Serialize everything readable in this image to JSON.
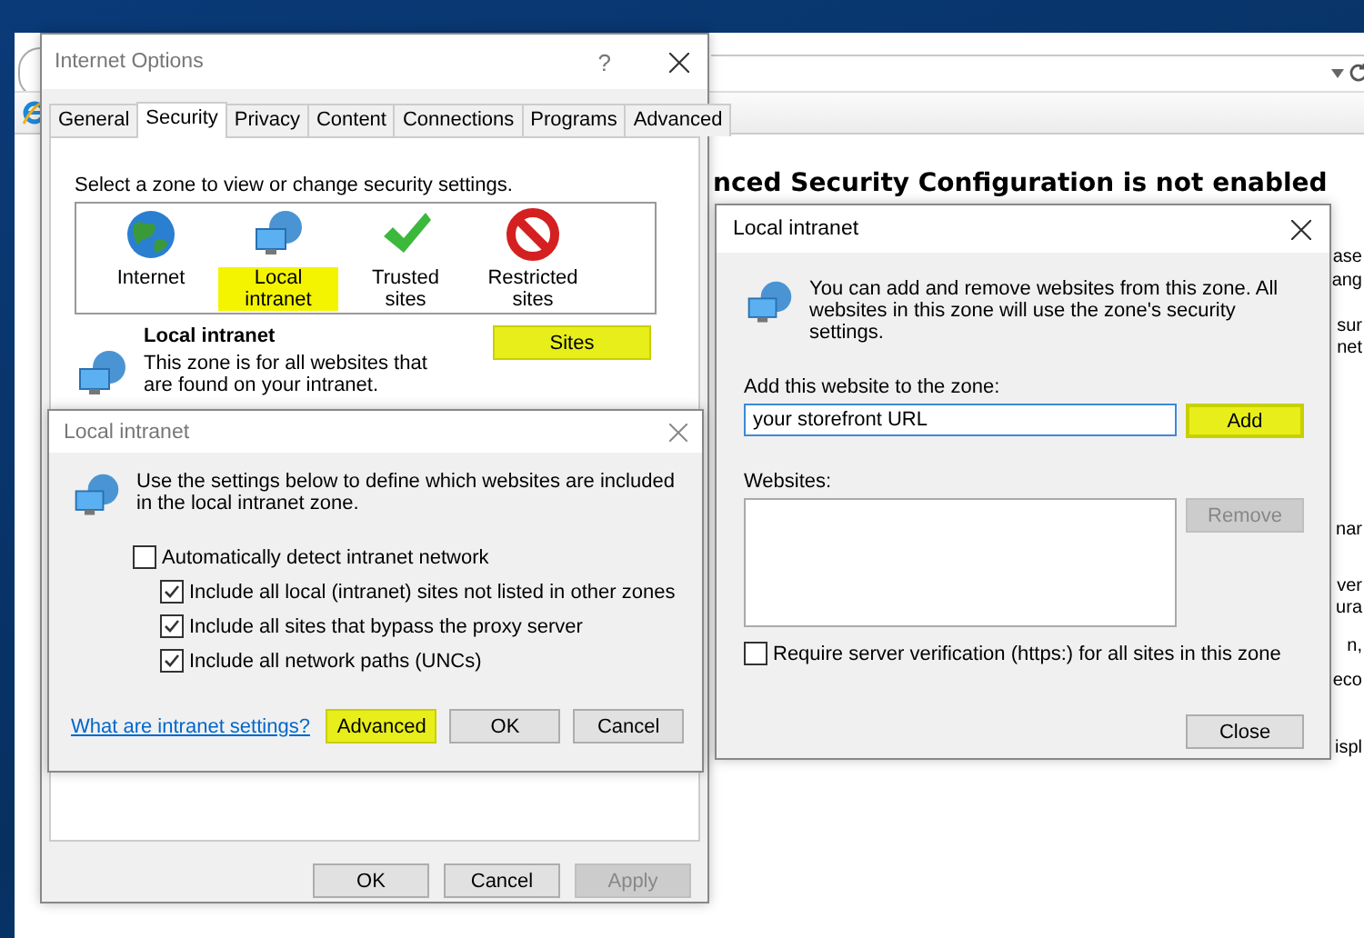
{
  "browser": {
    "heading": "nced Security Configuration is not enabled",
    "fragments": [
      "ase",
      "ang",
      "sur",
      "net",
      "nar",
      "ver",
      "ura",
      "n,",
      "eco",
      "ispl"
    ]
  },
  "internet_options": {
    "title": "Internet Options",
    "help": "?",
    "tabs": [
      {
        "label": "General",
        "selected": false
      },
      {
        "label": "Security",
        "selected": true
      },
      {
        "label": "Privacy",
        "selected": false
      },
      {
        "label": "Content",
        "selected": false
      },
      {
        "label": "Connections",
        "selected": false
      },
      {
        "label": "Programs",
        "selected": false
      },
      {
        "label": "Advanced",
        "selected": false
      }
    ],
    "zone_prompt": "Select a zone to view or change security settings.",
    "zones": [
      {
        "label": "Internet",
        "kind": "globe",
        "selected": false
      },
      {
        "label": "Local intranet",
        "kind": "intranet",
        "selected": true
      },
      {
        "label": "Trusted sites",
        "kind": "check",
        "selected": false
      },
      {
        "label": "Restricted sites",
        "kind": "blocked",
        "selected": false
      }
    ],
    "zone_title": "Local intranet",
    "zone_description": "This zone is for all websites that are found on your intranet.",
    "sites_button": {
      "label": "Sites",
      "highlighted": true
    },
    "buttons": [
      {
        "label": "OK",
        "disabled": false
      },
      {
        "label": "Cancel",
        "disabled": false
      },
      {
        "label": "Apply",
        "disabled": true
      }
    ]
  },
  "intranet_dialog": {
    "title": "Local intranet",
    "intro": "Use the settings below to define which websites are included in the local intranet zone.",
    "options": [
      {
        "label": "Automatically detect intranet network",
        "checked": false,
        "children": [
          {
            "label": "Include all local (intranet) sites not listed in other zones",
            "checked": true
          },
          {
            "label": "Include all sites that bypass the proxy server",
            "checked": true
          },
          {
            "label": "Include all network paths (UNCs)",
            "checked": true
          }
        ]
      }
    ],
    "link": "What are intranet settings?",
    "buttons": [
      {
        "label": "Advanced",
        "highlighted": true
      },
      {
        "label": "OK",
        "highlighted": false
      },
      {
        "label": "Cancel",
        "highlighted": false
      }
    ]
  },
  "sites_dialog": {
    "title": "Local intranet",
    "intro": "You can add and remove websites from this zone. All websites in this zone will use the zone's security settings.",
    "add_label": "Add this website to the zone:",
    "add_value": "your storefront URL",
    "add_button": {
      "label": "Add",
      "highlighted": true
    },
    "websites_label": "Websites:",
    "remove_button": {
      "label": "Remove",
      "disabled": true
    },
    "require_https": {
      "label": "Require server verification (https:) for all sites in this zone",
      "checked": false
    },
    "close_button": "Close"
  }
}
